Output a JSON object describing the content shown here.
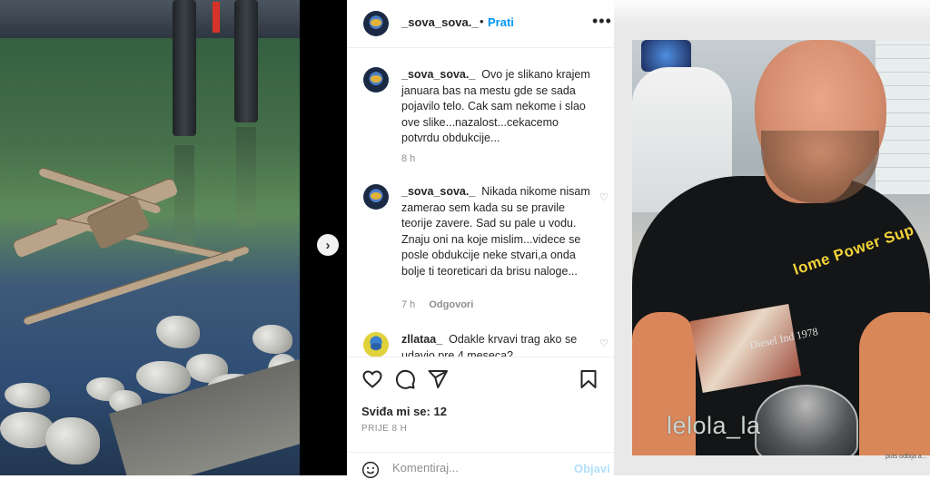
{
  "post": {
    "username": "_sova_sova._",
    "separator": "•",
    "follow_label": "Prati",
    "more_label": "•••"
  },
  "comments": [
    {
      "username": "_sova_sova._",
      "text": "Ovo je slikano krajem januara bas na mestu gde se sada pojavilo telo. Cak sam nekome i slao ove slike...nazalost...cekacemo potvrdu obdukcije...",
      "time": "8 h",
      "reply_label": "",
      "liked_icon": false
    },
    {
      "username": "_sova_sova._",
      "text": "Nikada nikome nisam zamerao sem kada su se pravile teorije zavere. Sad su pale u vodu. Znaju oni na koje mislim...videce se posle obdukcije neke stvari,a onda bolje ti teoreticari da brisu naloge...",
      "time": "7 h",
      "reply_label": "Odgovori",
      "liked_icon": true
    },
    {
      "username": "zllataa_",
      "text": "Odakle krvavi trag ako se udavio pre 4 meseca?",
      "time": "",
      "reply_label": "",
      "liked_icon": true
    }
  ],
  "actions": {
    "likes_label": "Sviđa mi se: 12",
    "posted_time": "PRIJE 8 H",
    "comment_placeholder": "Komentiraj...",
    "post_button": "Objavi"
  },
  "right_image": {
    "watermark": "lelola_la",
    "shirt_print": "lome Power Sup",
    "shirt_print_sub": "Diesel Ind 1978",
    "corner_caption": "puts odbija a..."
  },
  "colors": {
    "follow_blue": "#0095f6",
    "post_disabled": "#b2dffc",
    "text_primary": "#262626",
    "text_secondary": "#8e8e8e"
  }
}
